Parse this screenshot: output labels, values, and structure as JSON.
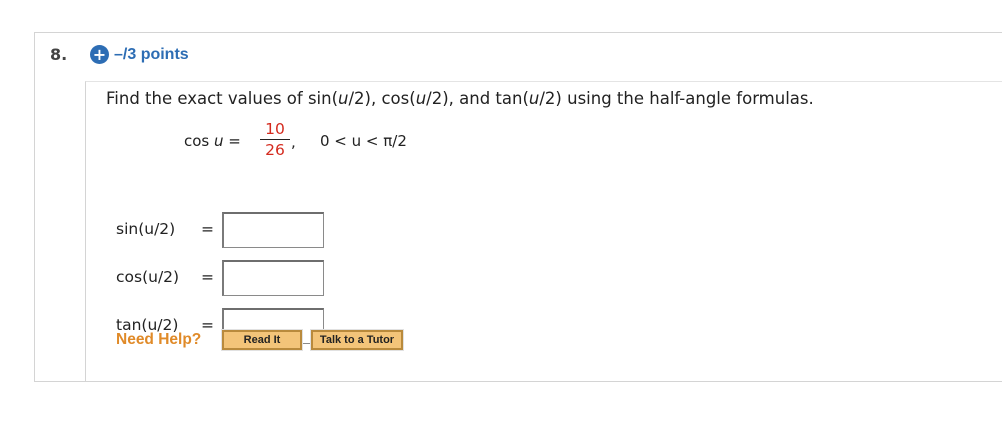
{
  "question": {
    "number": "8.",
    "points": "–/3 points",
    "prompt": {
      "before": "Find the exact values of  sin(",
      "u1": "u",
      "mid1": "/2), cos(",
      "u2": "u",
      "mid2": "/2), and tan(",
      "u3": "u",
      "after": "/2)  using the half-angle formulas."
    },
    "given": {
      "lhs_func": "cos ",
      "lhs_var": "u",
      "lhs_eq": " = ",
      "numerator": "10",
      "denominator": "26",
      "comma": ",",
      "condition": "0 < u < π/2"
    },
    "answers": [
      {
        "label": "sin(u/2)",
        "eq": "=",
        "value": ""
      },
      {
        "label": "cos(u/2)",
        "eq": "=",
        "value": ""
      },
      {
        "label": "tan(u/2)",
        "eq": "=",
        "value": ""
      }
    ],
    "help": {
      "label": "Need Help?",
      "read_it": "Read It",
      "tutor": "Talk to a Tutor"
    }
  },
  "colors": {
    "accent_blue": "#2d6db4",
    "fraction_red": "#d42a1e",
    "help_orange": "#e08a28",
    "button_fill": "#f3c479"
  }
}
